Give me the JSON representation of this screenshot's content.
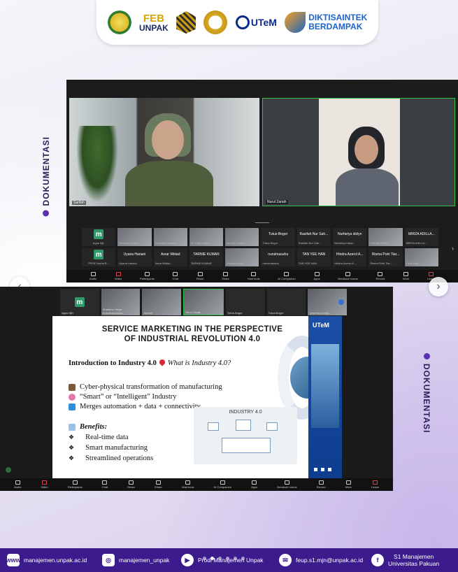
{
  "logos": {
    "feb_line1": "FEB",
    "feb_line2": "UNPAK",
    "utem": "UTeM",
    "dikti_line1": "DIKTISAINTEK",
    "dikti_line2": "BERDAMPAK"
  },
  "side_label": "DOKUMENTASI",
  "meeting1": {
    "speaker1_name": "Sarifah",
    "speaker2_name": "Nurul Zariah",
    "participants_row1": [
      {
        "name": "",
        "sub": "Agus Mjh",
        "kind": "m"
      },
      {
        "name": "",
        "sub": "Shabrina Hidya...",
        "kind": "pic"
      },
      {
        "name": "",
        "sub": "Sakinah Kasuma...",
        "kind": "pic"
      },
      {
        "name": "",
        "sub": "S1 Carit cahya...",
        "kind": "pic"
      },
      {
        "name": "",
        "sub": "Nur Ali Fasikha",
        "kind": "pic"
      },
      {
        "name": "Tutus-Bogor",
        "sub": "Tutus Bogor",
        "kind": "text"
      },
      {
        "name": "Rasifah Nur Sah...",
        "sub": "Rasifah Nur Sah...",
        "kind": "text"
      },
      {
        "name": "Nurfariya idzlyn",
        "sub": "Nurfariya idzlyn",
        "kind": "text"
      },
      {
        "name": "",
        "sub": "HADZILARIEE...",
        "kind": "pic"
      },
      {
        "name": "MIRZA ADILLA...",
        "sub": "MIRZA ADILLA...",
        "kind": "text"
      }
    ],
    "participants_row2": [
      {
        "name": "",
        "sub": "PROF Amha B...",
        "kind": "m"
      },
      {
        "name": "Uyana Hanani",
        "sub": "Uyana Hanani",
        "kind": "text"
      },
      {
        "name": "Asrar Widad",
        "sub": "Asrar Widad",
        "kind": "text"
      },
      {
        "name": "TARNIE KUMAR",
        "sub": "TARNIE KUMAR",
        "kind": "text"
      },
      {
        "name": "",
        "sub": "Andidakuraja",
        "kind": "pic"
      },
      {
        "name": "nurulmasuha",
        "sub": "nurulmasuha",
        "kind": "text"
      },
      {
        "name": "TAN YEE HAN",
        "sub": "TAN YEE HAN",
        "kind": "text"
      },
      {
        "name": "Hindra Azerol A...",
        "sub": "Hindra Azerol A...",
        "kind": "text"
      },
      {
        "name": "Risma Putri Tiar...",
        "sub": "Risma Putri Tiar...",
        "kind": "text"
      },
      {
        "name": "",
        "sub": "Fadil Mefu",
        "kind": "pic"
      }
    ],
    "extra_tile": "Khoerotunnisa...",
    "extra_tile_sub": "Khoerotunnisa...",
    "extra_tile2_sub": "tan wosliang"
  },
  "toolbar": [
    "Audio",
    "Video",
    "Participants",
    "Chat",
    "React",
    "Share",
    "Host tools",
    "AI Companion",
    "Apps",
    "Breakout rooms",
    "Record",
    "More",
    "Leave"
  ],
  "meeting2": {
    "top_tiles": [
      {
        "sub": "Agus Mjh",
        "kind": "m"
      },
      {
        "sub": "Shabrina Hidya Kusumawardani",
        "kind": "pic"
      },
      {
        "sub": "Sarifah",
        "kind": "pic"
      },
      {
        "sub": "Nurul Zariah",
        "kind": "pic"
      },
      {
        "sub": "Tutus-Bogor",
        "kind": "text"
      },
      {
        "sub": "Tutus Bogor",
        "kind": "text"
      },
      {
        "sub": "Qawenna Linna...",
        "kind": "pic"
      }
    ]
  },
  "slide": {
    "title_line1": "SERVICE MARKETING IN THE PERSPECTIVE",
    "title_line2": "OF INDUSTRIAL REVOLUTION 4.0",
    "intro_bold": "Introduction to Industry 4.0",
    "intro_italic": "What is Industry 4.0?",
    "bullets": [
      "Cyber-physical transformation of manufacturing",
      "“Smart” or “Intelligent” Industry",
      "Merges automation + data + connectivity"
    ],
    "benefits_label": "Benefits:",
    "benefit_items": [
      "Real-time data",
      "Smart manufacturing",
      "Streamlined operations"
    ],
    "illustration_caption": "INDUSTRY 4.0",
    "brand": "UTeM"
  },
  "footer": {
    "website": "manajemen.unpak.ac.id",
    "instagram": "manajemen_unpak",
    "youtube": "Prodi Manajemen Unpak",
    "email": "feup.s1.mjn@unpak.ac.id",
    "facebook_line1": "S1 Manajemen",
    "facebook_line2": "Universitas Pakuan"
  },
  "colors": {
    "footer_bg": "#3c1b8c",
    "accent_purple": "#5b2fb0",
    "zoom_active_border": "#35c04b",
    "utem_blue": "#1c4fa8"
  }
}
